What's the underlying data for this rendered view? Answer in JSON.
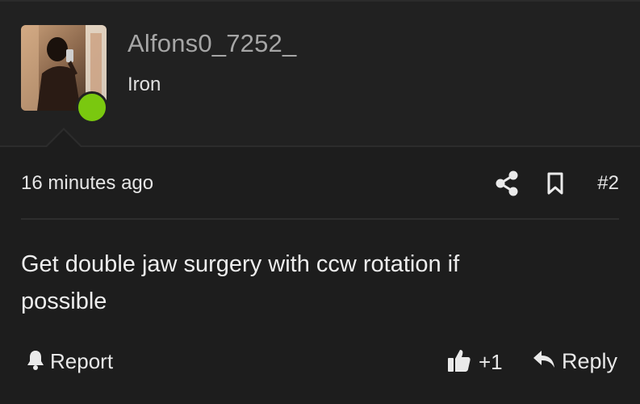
{
  "author": {
    "username": "Alfons0_7252_",
    "title": "Iron",
    "online": true,
    "avatar_icon": "avatar-photo",
    "status_color": "#7ac80f"
  },
  "meta": {
    "timestamp": "16 minutes ago",
    "share_icon": "share-icon",
    "bookmark_icon": "bookmark-icon",
    "post_number": "#2"
  },
  "post": {
    "body": "Get double jaw surgery with ccw rotation if possible"
  },
  "actions": {
    "report_label": "Report",
    "report_icon": "bell-icon",
    "like_icon": "thumbs-up-icon",
    "like_count": "+1",
    "reply_icon": "reply-icon",
    "reply_label": "Reply"
  },
  "colors": {
    "background": "#1d1d1d",
    "header_background": "#212121",
    "username": "#a6a6a6",
    "text": "#e8e8e8"
  }
}
